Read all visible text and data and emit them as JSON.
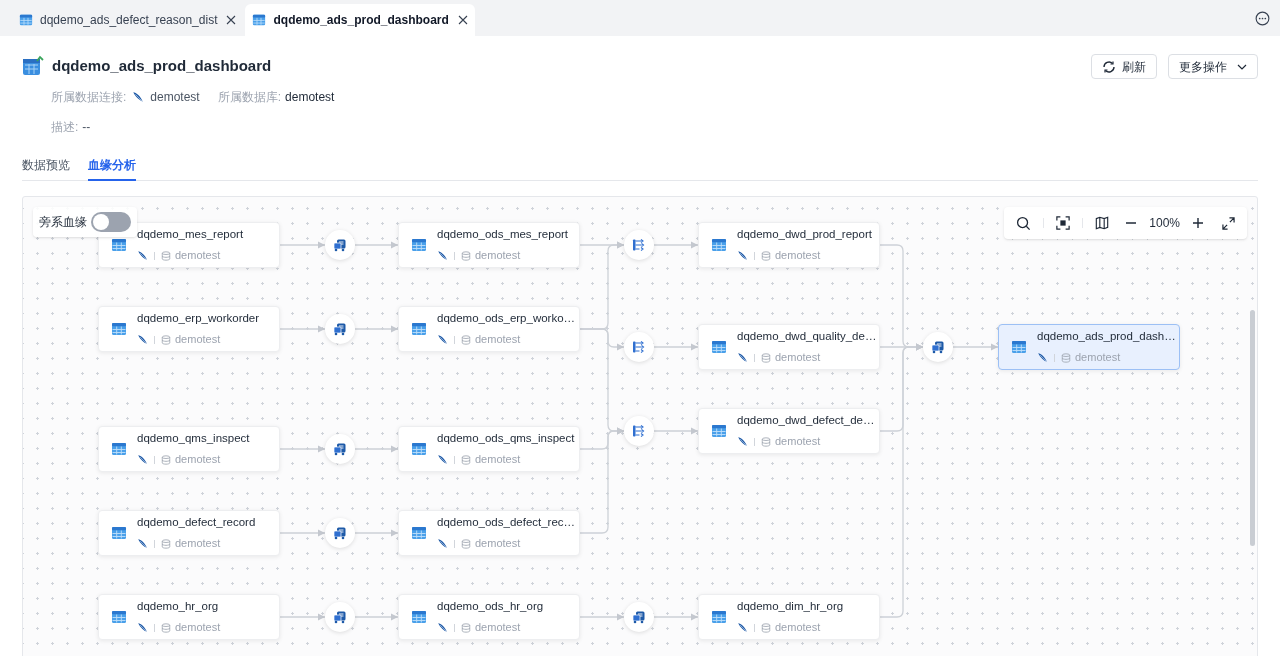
{
  "tabs": [
    {
      "label": "dqdemo_ads_defect_reason_dist",
      "selected": false
    },
    {
      "label": "dqdemo_ads_prod_dashboard",
      "selected": true
    }
  ],
  "title": "dqdemo_ads_prod_dashboard",
  "actions": [
    {
      "kind": "refresh",
      "label": "刷新"
    },
    {
      "kind": "menu",
      "label": "更多操作"
    }
  ],
  "meta": [
    {
      "kind": "connection",
      "label": "所属数据连接:",
      "value": "demotest"
    },
    {
      "kind": "database",
      "label": "所属数据库:",
      "value": "demotest"
    }
  ],
  "description": {
    "label": "描述:",
    "value": "--"
  },
  "view_tabs": [
    {
      "label": "数据预览",
      "selected": false
    },
    {
      "label": "血缘分析",
      "selected": true
    }
  ],
  "lineage": {
    "toggle": {
      "label": "旁系血缘",
      "on": false
    },
    "zoom": "100%",
    "nodes": [
      {
        "name": "dqdemo_mes_report",
        "database": "demotest",
        "selected": false
      },
      {
        "name": "dqdemo_erp_workorder",
        "database": "demotest",
        "selected": false
      },
      {
        "name": "dqdemo_qms_inspect",
        "database": "demotest",
        "selected": false
      },
      {
        "name": "dqdemo_defect_record",
        "database": "demotest",
        "selected": false
      },
      {
        "name": "dqdemo_hr_org",
        "database": "demotest",
        "selected": false
      },
      {
        "name": "dqdemo_ods_mes_report",
        "database": "demotest",
        "selected": false
      },
      {
        "name": "dqdemo_ods_erp_worko…",
        "database": "demotest",
        "selected": false
      },
      {
        "name": "dqdemo_ods_qms_inspect",
        "database": "demotest",
        "selected": false
      },
      {
        "name": "dqdemo_ods_defect_rec…",
        "database": "demotest",
        "selected": false
      },
      {
        "name": "dqdemo_ods_hr_org",
        "database": "demotest",
        "selected": false
      },
      {
        "name": "dqdemo_dwd_prod_report",
        "database": "demotest",
        "selected": false
      },
      {
        "name": "dqdemo_dwd_quality_de…",
        "database": "demotest",
        "selected": false
      },
      {
        "name": "dqdemo_dwd_defect_de…",
        "database": "demotest",
        "selected": false
      },
      {
        "name": "dqdemo_dim_hr_org",
        "database": "demotest",
        "selected": false
      },
      {
        "name": "dqdemo_ads_prod_dash…",
        "database": "demotest",
        "selected": true
      }
    ],
    "tasks": [
      {
        "kind": "sync"
      },
      {
        "kind": "sync"
      },
      {
        "kind": "sync"
      },
      {
        "kind": "sync"
      },
      {
        "kind": "sync"
      },
      {
        "kind": "transform"
      },
      {
        "kind": "transform"
      },
      {
        "kind": "transform"
      },
      {
        "kind": "sync"
      },
      {
        "kind": "sync"
      }
    ]
  }
}
